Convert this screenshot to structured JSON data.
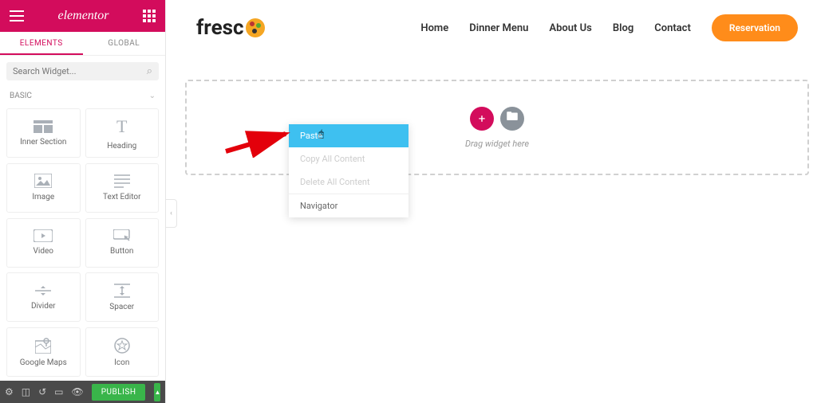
{
  "panel": {
    "brand": "elementor",
    "tabs": {
      "elements": "ELEMENTS",
      "global": "GLOBAL"
    },
    "search_placeholder": "Search Widget...",
    "category": "BASIC",
    "widgets": [
      {
        "label": "Inner Section",
        "icon": "inner-section"
      },
      {
        "label": "Heading",
        "icon": "heading"
      },
      {
        "label": "Image",
        "icon": "image"
      },
      {
        "label": "Text Editor",
        "icon": "text-editor"
      },
      {
        "label": "Video",
        "icon": "video"
      },
      {
        "label": "Button",
        "icon": "button"
      },
      {
        "label": "Divider",
        "icon": "divider"
      },
      {
        "label": "Spacer",
        "icon": "spacer"
      },
      {
        "label": "Google Maps",
        "icon": "google-maps"
      },
      {
        "label": "Icon",
        "icon": "icon"
      }
    ],
    "publish": "PUBLISH"
  },
  "site": {
    "logo_text": "fresc",
    "nav": {
      "home": "Home",
      "dinner": "Dinner Menu",
      "about": "About Us",
      "blog": "Blog",
      "contact": "Contact"
    },
    "cta": "Reservation",
    "drop_hint": "Drag widget here"
  },
  "context_menu": {
    "paste": "Paste",
    "copy_all": "Copy All Content",
    "delete_all": "Delete All Content",
    "navigator": "Navigator"
  }
}
